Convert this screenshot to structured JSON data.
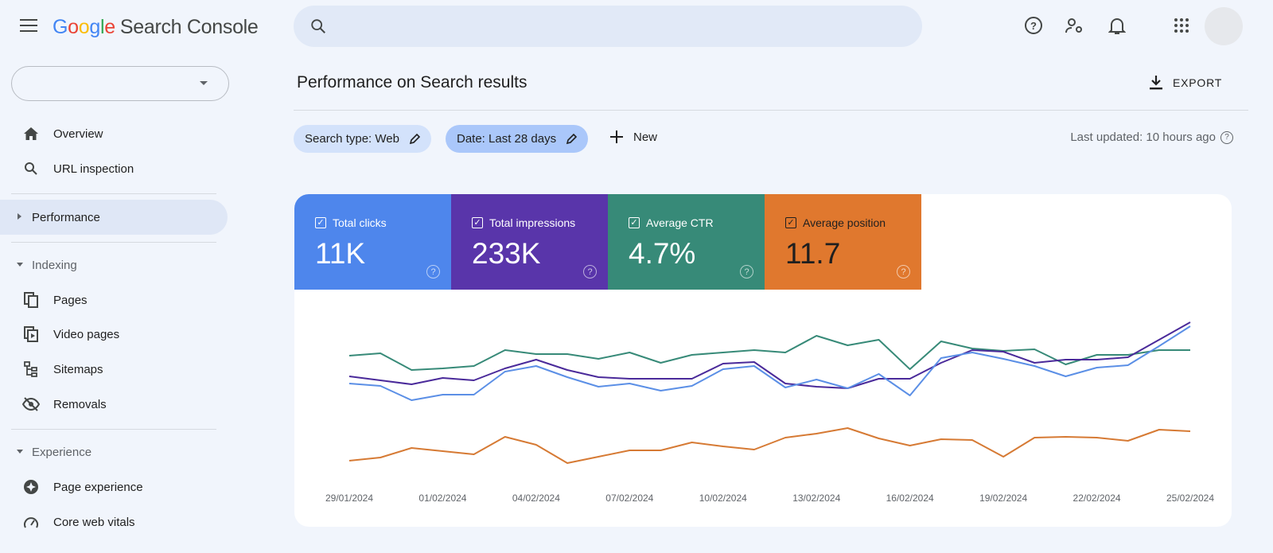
{
  "app": {
    "logo_google": "Google",
    "logo_product": "Search Console"
  },
  "search": {
    "placeholder": ""
  },
  "toolbar": {
    "icons": [
      "help-icon",
      "manage-users-icon",
      "notifications-icon",
      "apps-grid-icon",
      "avatar"
    ]
  },
  "property_selector": {
    "value": ""
  },
  "sidebar": {
    "items": [
      {
        "label": "Overview",
        "icon": "home-icon"
      },
      {
        "label": "URL inspection",
        "icon": "search-icon"
      },
      {
        "label": "Performance",
        "icon": "caret-right-icon",
        "selected": true
      },
      {
        "label": "Indexing",
        "section": true
      },
      {
        "label": "Pages",
        "icon": "pages-icon"
      },
      {
        "label": "Video pages",
        "icon": "video-pages-icon"
      },
      {
        "label": "Sitemaps",
        "icon": "sitemaps-icon"
      },
      {
        "label": "Removals",
        "icon": "removals-icon"
      },
      {
        "label": "Experience",
        "section": true
      },
      {
        "label": "Page experience",
        "icon": "page-experience-icon"
      },
      {
        "label": "Core web vitals",
        "icon": "gauge-icon"
      }
    ]
  },
  "main": {
    "title": "Performance on Search results",
    "export_label": "EXPORT",
    "filters": [
      {
        "label": "Search type: Web"
      },
      {
        "label": "Date: Last 28 days"
      }
    ],
    "new_label": "New",
    "last_updated": "Last updated: 10 hours ago"
  },
  "metrics": [
    {
      "label": "Total clicks",
      "value": "11K",
      "color": "#4e86ec",
      "checked": true
    },
    {
      "label": "Total impressions",
      "value": "233K",
      "color": "#5935aa",
      "checked": true
    },
    {
      "label": "Average CTR",
      "value": "4.7%",
      "color": "#378a78",
      "checked": true
    },
    {
      "label": "Average position",
      "value": "11.7",
      "color": "#e0782e",
      "checked": true
    }
  ],
  "chart_data": {
    "type": "line",
    "title": "",
    "xlabel": "",
    "ylabel": "",
    "y_axis_visible": false,
    "ylim": [
      0,
      220
    ],
    "grid": false,
    "x": [
      "29/01/2024",
      "30/01/2024",
      "31/01/2024",
      "01/02/2024",
      "02/02/2024",
      "03/02/2024",
      "04/02/2024",
      "05/02/2024",
      "06/02/2024",
      "07/02/2024",
      "08/02/2024",
      "09/02/2024",
      "10/02/2024",
      "11/02/2024",
      "12/02/2024",
      "13/02/2024",
      "14/02/2024",
      "15/02/2024",
      "16/02/2024",
      "17/02/2024",
      "18/02/2024",
      "19/02/2024",
      "20/02/2024",
      "21/02/2024",
      "22/02/2024",
      "23/02/2024",
      "24/02/2024",
      "25/02/2024"
    ],
    "tick_labels": [
      "29/01/2024",
      "01/02/2024",
      "04/02/2024",
      "07/02/2024",
      "10/02/2024",
      "13/02/2024",
      "16/02/2024",
      "19/02/2024",
      "22/02/2024",
      "25/02/2024"
    ],
    "series": [
      {
        "name": "Average CTR",
        "color": "#378a78",
        "values": [
          153,
          156,
          135,
          137,
          140,
          160,
          155,
          155,
          149,
          157,
          144,
          154,
          157,
          160,
          157,
          178,
          166,
          173,
          136,
          171,
          162,
          159,
          161,
          142,
          154,
          154,
          160,
          160
        ]
      },
      {
        "name": "Total impressions",
        "color": "#4a2a9a",
        "values": [
          127,
          122,
          117,
          125,
          122,
          137,
          148,
          135,
          126,
          124,
          124,
          124,
          143,
          145,
          118,
          114,
          112,
          124,
          124,
          144,
          160,
          158,
          144,
          148,
          148,
          151,
          173,
          195
        ]
      },
      {
        "name": "Total clicks",
        "color": "#5b8fe6",
        "values": [
          118,
          115,
          97,
          104,
          104,
          133,
          140,
          126,
          114,
          118,
          109,
          115,
          136,
          140,
          113,
          123,
          112,
          130,
          103,
          150,
          157,
          149,
          140,
          127,
          138,
          141,
          165,
          190
        ]
      },
      {
        "name": "Average position",
        "color": "#d67a34",
        "values": [
          21,
          25,
          37,
          33,
          29,
          51,
          41,
          18,
          26,
          34,
          34,
          44,
          39,
          35,
          50,
          55,
          62,
          49,
          40,
          48,
          47,
          26,
          50,
          51,
          50,
          46,
          60,
          58
        ]
      }
    ]
  }
}
